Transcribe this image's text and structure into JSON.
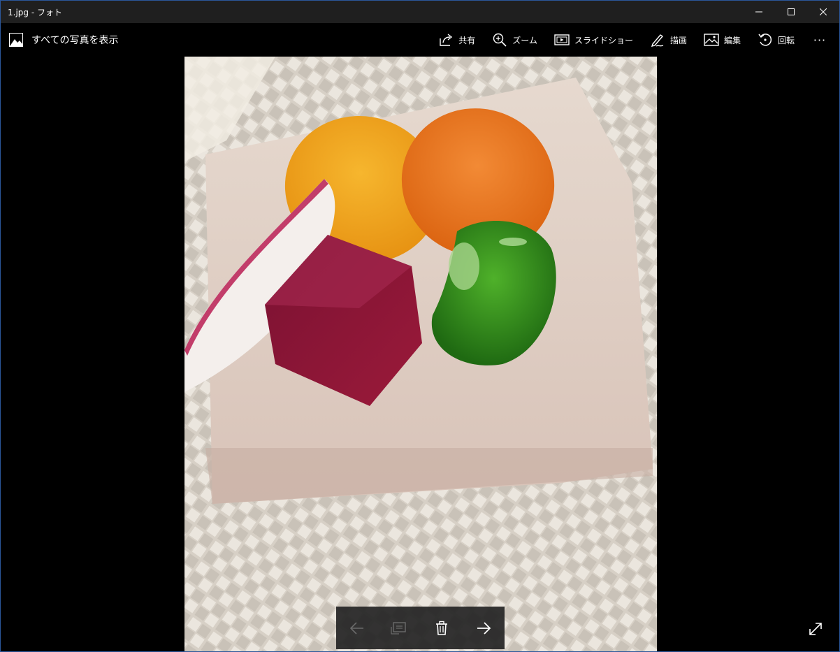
{
  "window": {
    "title": "1.jpg - フォト"
  },
  "cmdbar": {
    "back_label": "すべての写真を表示",
    "items": [
      {
        "label": "共有",
        "icon": "share-icon"
      },
      {
        "label": "ズーム",
        "icon": "zoom-icon"
      },
      {
        "label": "スライドショー",
        "icon": "slideshow-icon"
      },
      {
        "label": "描画",
        "icon": "draw-icon"
      },
      {
        "label": "編集",
        "icon": "edit-icon"
      },
      {
        "label": "回転",
        "icon": "rotate-icon"
      }
    ],
    "more": "···"
  },
  "colors": {
    "background": "#000000",
    "titlebar": "#1f1f1f",
    "accent_border": "#2b579a",
    "nav_disabled": "#6b6b6b"
  },
  "photo": {
    "subject": "vegetables on ice block"
  },
  "nav": {
    "prev_icon": "arrow-left-icon",
    "filmstrip_icon": "filmstrip-icon",
    "delete_icon": "trash-icon",
    "next_icon": "arrow-right-icon"
  }
}
